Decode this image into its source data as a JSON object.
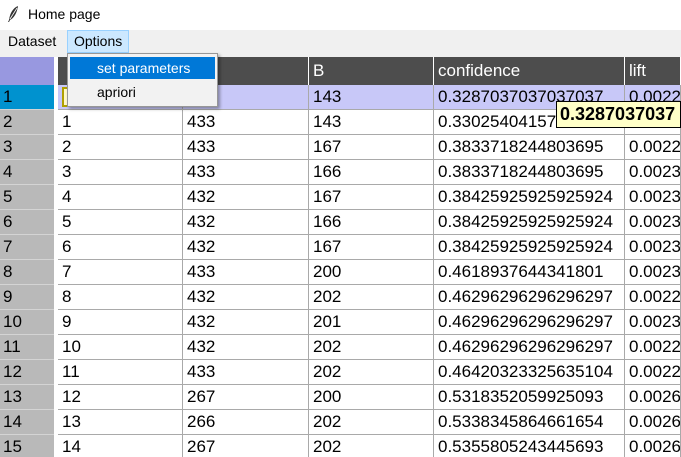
{
  "window": {
    "title": "Home page",
    "icon": "feather-icon"
  },
  "menubar": {
    "items": [
      {
        "label": "Dataset"
      },
      {
        "label": "Options"
      }
    ]
  },
  "options_menu": {
    "items": [
      {
        "label": "set parameters",
        "highlighted": true
      },
      {
        "label": "apriori"
      }
    ]
  },
  "table": {
    "columns": [
      "",
      "",
      "B",
      "confidence",
      "lift"
    ],
    "selected_row_index": 0,
    "rows": [
      {
        "num": "1",
        "cells": [
          "",
          "",
          "143",
          "0.3287037037037037",
          "0.0022"
        ]
      },
      {
        "num": "2",
        "cells": [
          "1",
          "433",
          "143",
          "0.3302540415704388",
          "0.0023"
        ]
      },
      {
        "num": "3",
        "cells": [
          "2",
          "433",
          "167",
          "0.3833718244803695",
          "0.0022"
        ]
      },
      {
        "num": "4",
        "cells": [
          "3",
          "433",
          "166",
          "0.3833718244803695",
          "0.0023"
        ]
      },
      {
        "num": "5",
        "cells": [
          "4",
          "432",
          "167",
          "0.38425925925925924",
          "0.0023"
        ]
      },
      {
        "num": "6",
        "cells": [
          "5",
          "432",
          "166",
          "0.38425925925925924",
          "0.0023"
        ]
      },
      {
        "num": "7",
        "cells": [
          "6",
          "432",
          "167",
          "0.38425925925925924",
          "0.0023"
        ]
      },
      {
        "num": "8",
        "cells": [
          "7",
          "433",
          "200",
          "0.4618937644341801",
          "0.0023"
        ]
      },
      {
        "num": "9",
        "cells": [
          "8",
          "432",
          "202",
          "0.46296296296296297",
          "0.0022"
        ]
      },
      {
        "num": "10",
        "cells": [
          "9",
          "432",
          "201",
          "0.46296296296296297",
          "0.0023"
        ]
      },
      {
        "num": "11",
        "cells": [
          "10",
          "432",
          "202",
          "0.46296296296296297",
          "0.0022"
        ]
      },
      {
        "num": "12",
        "cells": [
          "11",
          "433",
          "202",
          "0.46420323325635104",
          "0.0022"
        ]
      },
      {
        "num": "13",
        "cells": [
          "12",
          "267",
          "200",
          "0.5318352059925093",
          "0.0026"
        ]
      },
      {
        "num": "14",
        "cells": [
          "13",
          "266",
          "202",
          "0.5338345864661654",
          "0.0026"
        ]
      },
      {
        "num": "15",
        "cells": [
          "14",
          "267",
          "202",
          "0.5355805243445693",
          "0.0026"
        ]
      }
    ]
  },
  "tooltip": {
    "text": "0.3287037037"
  },
  "colors": {
    "header_bg": "#4d4d4d",
    "corner_bg": "#9898e0",
    "rownum_bg": "#b9b9b9",
    "selected_rownum_bg": "#0092cf",
    "selected_row_bg": "#c8c8f8",
    "menu_highlight": "#0078d7",
    "tooltip_bg": "#ffffc8"
  }
}
